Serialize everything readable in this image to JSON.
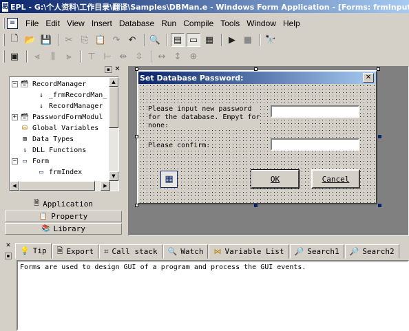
{
  "window": {
    "title": "EPL - G:\\个人资料\\工作目录\\翻译\\Samples\\DBMan.e - Windows Form Application - [Forms: frmInputP",
    "app_icon": "epl-app-icon"
  },
  "menu": {
    "items": [
      "File",
      "Edit",
      "View",
      "Insert",
      "Database",
      "Run",
      "Compile",
      "Tools",
      "Window",
      "Help"
    ]
  },
  "toolbar1": {
    "buttons": [
      "new-file-icon",
      "open-folder-icon",
      "save-icon",
      "cut-icon",
      "copy-icon",
      "paste-icon",
      "redo-icon",
      "undo-icon",
      "find-icon",
      "layout-1-icon",
      "layout-2-icon",
      "layout-3-icon",
      "run-icon",
      "stop-icon",
      "debug-icon"
    ]
  },
  "toolbar2": {
    "buttons": [
      "form-design-icon",
      "align-left-icon",
      "align-center-icon",
      "align-right-icon",
      "align-top-icon",
      "align-middle-icon",
      "space-horiz-icon",
      "space-vert-icon",
      "same-width-icon",
      "same-height-icon",
      "center-form-icon"
    ]
  },
  "tree": {
    "items": [
      {
        "label": "RecordManager",
        "level": 0,
        "expander": "−",
        "icon": "db-icon"
      },
      {
        "label": "_frmRecordMan_",
        "level": 1,
        "expander": "",
        "icon": "sub-icon"
      },
      {
        "label": "RecordManager",
        "level": 1,
        "expander": "",
        "icon": "sub-icon"
      },
      {
        "label": "PasswordFormModul",
        "level": 0,
        "expander": "+",
        "icon": "db-icon"
      },
      {
        "label": "Global Variables",
        "level": 0,
        "expander": "",
        "icon": "global-icon"
      },
      {
        "label": "Data Types",
        "level": 0,
        "expander": "",
        "icon": "types-icon"
      },
      {
        "label": "DLL Functions",
        "level": 0,
        "expander": "",
        "icon": "dll-icon"
      },
      {
        "label": "Form",
        "level": 0,
        "expander": "−",
        "icon": "form-icon"
      },
      {
        "label": "frmIndex",
        "level": 1,
        "expander": "",
        "icon": "form-icon"
      }
    ]
  },
  "panel_tabs": [
    {
      "label": "Application",
      "icon": "application-icon"
    },
    {
      "label": "Property",
      "icon": "property-icon"
    },
    {
      "label": "Library",
      "icon": "library-icon"
    }
  ],
  "form": {
    "title": "Set Database Password:",
    "label1": "Please input new password\nfor the database. Empyt for\nnone:",
    "label2": "Please confirm:",
    "input1_value": "",
    "input2_value": "",
    "ok_label": "OK",
    "cancel_label": "Cancel"
  },
  "bottom_tabs": [
    {
      "label": "Tip",
      "icon": "tip-icon",
      "active": true
    },
    {
      "label": "Export",
      "icon": "export-icon"
    },
    {
      "label": "Call stack",
      "icon": "callstack-icon"
    },
    {
      "label": "Watch",
      "icon": "watch-icon"
    },
    {
      "label": "Variable List",
      "icon": "variables-icon"
    },
    {
      "label": "Search1",
      "icon": "search1-icon"
    },
    {
      "label": "Search2",
      "icon": "search2-icon"
    }
  ],
  "output": {
    "text": "Forms are used to design GUI of a program and process the GUI events."
  },
  "colors": {
    "titlebar_start": "#0a246a",
    "titlebar_end": "#a6caf0",
    "face": "#d4d0c8",
    "design_bg": "#808080"
  }
}
